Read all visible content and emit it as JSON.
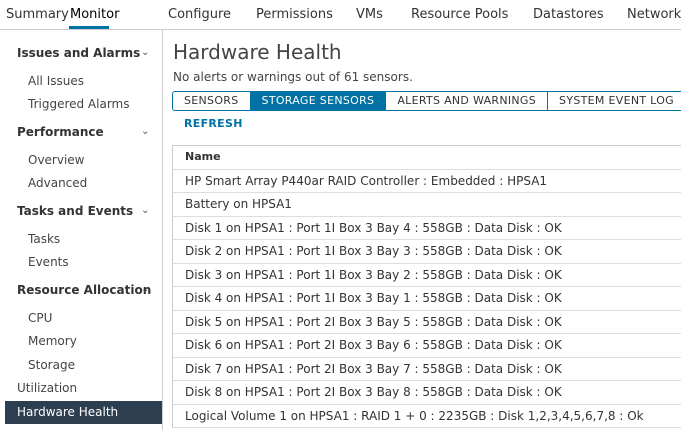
{
  "tabs": [
    "Summary",
    "Monitor",
    "Configure",
    "Permissions",
    "VMs",
    "Resource Pools",
    "Datastores",
    "Networks"
  ],
  "sidebar": {
    "issues": {
      "label": "Issues and Alarms",
      "items": [
        "All Issues",
        "Triggered Alarms"
      ]
    },
    "performance": {
      "label": "Performance",
      "items": [
        "Overview",
        "Advanced"
      ]
    },
    "tasks": {
      "label": "Tasks and Events",
      "items": [
        "Tasks",
        "Events"
      ]
    },
    "resources": {
      "label": "Resource Allocation",
      "items": [
        "CPU",
        "Memory",
        "Storage"
      ]
    },
    "utilization": "Utilization",
    "hardware_health": "Hardware Health"
  },
  "main": {
    "title": "Hardware Health",
    "subtitle": "No alerts or warnings out of 61 sensors.",
    "segments": [
      "SENSORS",
      "STORAGE SENSORS",
      "ALERTS AND WARNINGS",
      "SYSTEM EVENT LOG"
    ],
    "refresh": "REFRESH",
    "table": {
      "header": "Name",
      "rows": [
        "HP Smart Array P440ar RAID Controller : Embedded : HPSA1",
        "Battery on HPSA1",
        "Disk 1 on HPSA1 : Port 1I Box 3 Bay 4 : 558GB : Data Disk : OK",
        "Disk 2 on HPSA1 : Port 1I Box 3 Bay 3 : 558GB : Data Disk : OK",
        "Disk 3 on HPSA1 : Port 1I Box 3 Bay 2 : 558GB : Data Disk : OK",
        "Disk 4 on HPSA1 : Port 1I Box 3 Bay 1 : 558GB : Data Disk : OK",
        "Disk 5 on HPSA1 : Port 2I Box 3 Bay 5 : 558GB : Data Disk : OK",
        "Disk 6 on HPSA1 : Port 2I Box 3 Bay 6 : 558GB : Data Disk : OK",
        "Disk 7 on HPSA1 : Port 2I Box 3 Bay 7 : 558GB : Data Disk : OK",
        "Disk 8 on HPSA1 : Port 2I Box 3 Bay 8 : 558GB : Data Disk : OK",
        "Logical Volume 1 on HPSA1 : RAID 1 + 0 : 2235GB : Disk 1,2,3,4,5,6,7,8 : Ok"
      ]
    }
  }
}
